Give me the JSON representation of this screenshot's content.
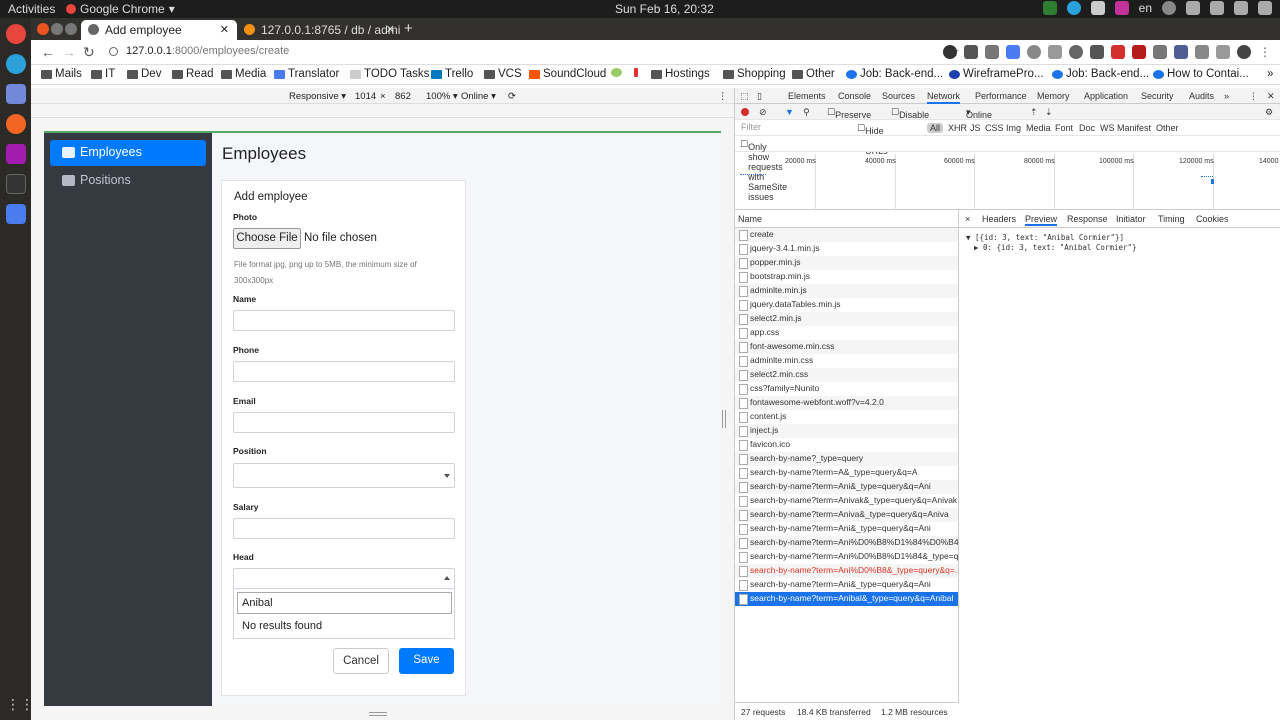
{
  "topbar": {
    "activities": "Activities",
    "app": "Google Chrome",
    "clock": "Sun Feb 16, 20:32",
    "lang": "en"
  },
  "tabs": [
    {
      "title": "Add employee",
      "active": true
    },
    {
      "title": "127.0.0.1:8765 / db / admi",
      "active": false
    }
  ],
  "new_tab": "+",
  "url": {
    "host": "127.0.0.1",
    "rest": ":8000/employees/create"
  },
  "bookmarks": [
    "Mails",
    "IT",
    "Dev",
    "Read",
    "Media",
    "Translator",
    "TODO Tasks",
    "Trello",
    "VCS",
    "SoundCloud",
    "Hostings",
    "Shopping",
    "Other",
    "Job: Back-end...",
    "WireframePro...",
    "Job: Back-end...",
    "How to Contai..."
  ],
  "devbar": {
    "mode": "Responsive ▾",
    "width": "1014",
    "x": "×",
    "height": "862",
    "zoom": "100% ▾",
    "net": "Online ▾"
  },
  "sidebar": [
    {
      "label": "Employees",
      "active": true
    },
    {
      "label": "Positions",
      "active": false
    }
  ],
  "page": {
    "title": "Employees",
    "card_title": "Add employee",
    "photo_label": "Photo",
    "choose_file": "Choose File",
    "no_file": "No file chosen",
    "hint": "File format jpg, png up to 5MB, the minimum size of 300x300px",
    "name_label": "Name",
    "phone_label": "Phone",
    "email_label": "Email",
    "position_label": "Position",
    "salary_label": "Salary",
    "head_label": "Head",
    "search_value": "Anibal",
    "no_results": "No results found",
    "cancel": "Cancel",
    "save": "Save"
  },
  "devtools": {
    "tabs": [
      "Elements",
      "Console",
      "Sources",
      "Network",
      "Performance",
      "Memory",
      "Application",
      "Security",
      "Audits",
      "»"
    ],
    "active_tab": "Network",
    "toolbar": {
      "preserve": "Preserve log",
      "disable_cache": "Disable cache",
      "online": "Online"
    },
    "filter_placeholder": "Filter",
    "filter_types": [
      "Hide data URLs",
      "All",
      "XHR",
      "JS",
      "CSS",
      "Img",
      "Media",
      "Font",
      "Doc",
      "WS",
      "Manifest",
      "Other"
    ],
    "samesite": "Only show requests with SameSite issues",
    "ticks": [
      "20000 ms",
      "40000 ms",
      "60000 ms",
      "80000 ms",
      "100000 ms",
      "120000 ms",
      "14000"
    ],
    "name_header": "Name",
    "requests": [
      "create",
      "jquery-3.4.1.min.js",
      "popper.min.js",
      "bootstrap.min.js",
      "adminlte.min.js",
      "jquery.dataTables.min.js",
      "select2.min.js",
      "app.css",
      "font-awesome.min.css",
      "adminlte.min.css",
      "select2.min.css",
      "css?family=Nunito",
      "fontawesome-webfont.woff?v=4.2.0",
      "content.js",
      "inject.js",
      "favicon.ico",
      "search-by-name?_type=query",
      "search-by-name?term=A&_type=query&q=A",
      "search-by-name?term=Ani&_type=query&q=Ani",
      "search-by-name?term=Anivak&_type=query&q=Anivak",
      "search-by-name?term=Aniva&_type=query&q=Aniva",
      "search-by-name?term=Ani&_type=query&q=Ani",
      "search-by-name?term=Ani%D0%B8%D1%84%D0%B4...",
      "search-by-name?term=Ani%D0%B8%D1%84&_type=q...",
      "search-by-name?term=Ani%D0%B8&_type=query&q=...",
      "search-by-name?term=Ani&_type=query&q=Ani",
      "search-by-name?term=Anibal&_type=query&q=Anibal"
    ],
    "detail_tabs": [
      "×",
      "Headers",
      "Preview",
      "Response",
      "Initiator",
      "Timing",
      "Cookies"
    ],
    "preview_line1": "▼ [{id: 3, text: \"Anibal Cormier\"}]",
    "preview_line2": "▶ 0: {id: 3, text: \"Anibal Cormier\"}",
    "status": {
      "requests": "27 requests",
      "transferred": "18.4 KB transferred",
      "resources": "1.2 MB resources"
    }
  }
}
